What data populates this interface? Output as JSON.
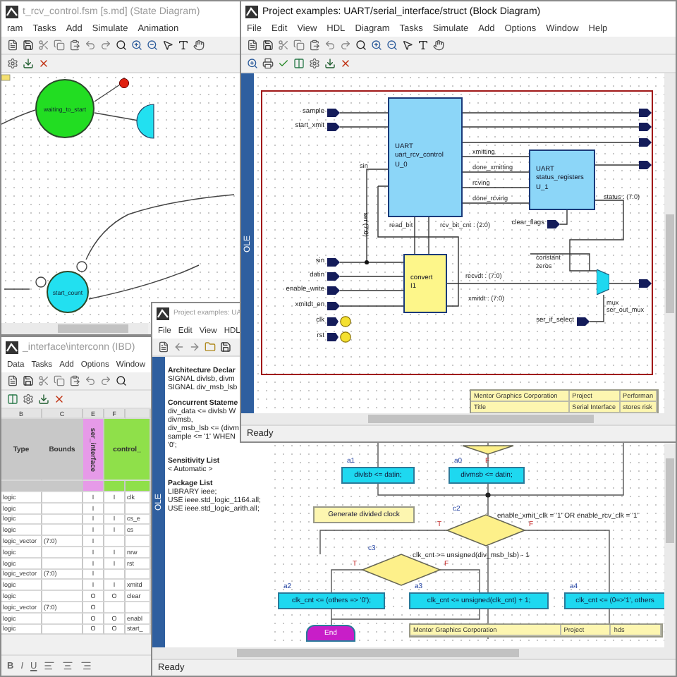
{
  "state_window": {
    "title": "t_rcv_control.fsm [s.md] (State Diagram)",
    "active": false,
    "menu": [
      "ram",
      "Tasks",
      "Add",
      "Simulate",
      "Animation"
    ],
    "states": [
      {
        "label": "waiting_to_start",
        "color": "#22dd22"
      },
      {
        "label": "start_count",
        "color": "#22e0f0"
      }
    ]
  },
  "ibd_window": {
    "title": "_interface\\interconn (IBD)",
    "active": false,
    "menu": [
      "Data",
      "Tasks",
      "Add",
      "Options",
      "Window"
    ],
    "column_letters": [
      "B",
      "C",
      "E",
      "F"
    ],
    "columns": [
      {
        "label": "Type",
        "kind": "plain"
      },
      {
        "label": "Bounds",
        "kind": "plain"
      },
      {
        "label": "ser_interface",
        "kind": "instance"
      },
      {
        "label": "control_",
        "kind": "block"
      }
    ],
    "rows": [
      {
        "type": "logic",
        "e": "I",
        "f": "I",
        "net": "clk"
      },
      {
        "type": "logic",
        "e": "I"
      },
      {
        "type": "logic",
        "e": "I",
        "f": "I",
        "net": "cs_e"
      },
      {
        "type": "logic",
        "e": "I",
        "f": "I",
        "net": "cs"
      },
      {
        "type": "logic_vector",
        "bounds": "(7:0)",
        "e": "I"
      },
      {
        "type": "logic",
        "e": "I",
        "f": "I",
        "net": "nrw"
      },
      {
        "type": "logic",
        "e": "I",
        "f": "I",
        "net": "rst"
      },
      {
        "type": "logic_vector",
        "bounds": "(7:0)",
        "e": "I"
      },
      {
        "type": "logic",
        "e": "I",
        "f": "I",
        "net": "xmitd"
      },
      {
        "type": "logic",
        "e": "O",
        "f": "O",
        "net": "clear"
      },
      {
        "type": "logic_vector",
        "bounds": "(7:0)",
        "e": "O"
      },
      {
        "type": "logic",
        "e": "O",
        "f": "O",
        "net": "enabl"
      },
      {
        "type": "logic",
        "e": "O",
        "f": "O",
        "net": "start_"
      }
    ],
    "format_buttons": [
      "B",
      "I",
      "U"
    ]
  },
  "flow_window": {
    "title": "Project examples: UA",
    "active": false,
    "menu": [
      "File",
      "Edit",
      "View",
      "HDL"
    ],
    "side_strip": "OLE",
    "declarations": [
      {
        "kind": "heading",
        "text": "Architecture Declar"
      },
      {
        "kind": "code",
        "text": "SIGNAL divlsb, divm"
      },
      {
        "kind": "code",
        "text": "SIGNAL div_msb_lsb"
      },
      {
        "kind": "heading",
        "text": "Concurrent Stateme"
      },
      {
        "kind": "code",
        "text": "div_data <= divlsb W"
      },
      {
        "kind": "code",
        "text": "divmsb,"
      },
      {
        "kind": "code",
        "text": "div_msb_lsb <= (divm"
      },
      {
        "kind": "code",
        "text": "sample <= '1' WHEN"
      },
      {
        "kind": "code",
        "text": "'0';"
      },
      {
        "kind": "heading",
        "text": "Sensitivity List"
      },
      {
        "kind": "code",
        "text": "< Automatic >"
      },
      {
        "kind": "heading",
        "text": "Package List"
      },
      {
        "kind": "code",
        "text": "LIBRARY ieee;"
      },
      {
        "kind": "code",
        "text": "USE ieee.std_logic_1164.all;"
      },
      {
        "kind": "code",
        "text": "USE ieee.std_logic_arith.all;"
      }
    ],
    "nodes": [
      {
        "kind": "action",
        "tag": "a1",
        "text": "divlsb <= datin;"
      },
      {
        "kind": "action",
        "tag": "a0",
        "text": "divmsb <= datin;",
        "branch_label": "F"
      },
      {
        "kind": "note",
        "text": "Generate divided clock"
      },
      {
        "kind": "decision",
        "tag": "c2",
        "condition": "enable_xmit_clk = '1' OR enable_rcv_clk = '1'",
        "true_label": "T",
        "false_label": "F"
      },
      {
        "kind": "decision",
        "tag": "c3",
        "condition": "clk_cnt >= unsigned(div_msb_lsb) - 1",
        "true_label": "T",
        "false_label": "F"
      },
      {
        "kind": "action",
        "tag": "a2",
        "text": "clk_cnt <= (others => '0');"
      },
      {
        "kind": "action",
        "tag": "a3",
        "text": "clk_cnt <= unsigned(clk_cnt) + 1;"
      },
      {
        "kind": "action",
        "tag": "a4",
        "text": "clk_cnt <= (0=>'1', others"
      },
      {
        "kind": "end",
        "text": "End"
      }
    ],
    "title_block": [
      "Mentor Graphics Corporation",
      "Project",
      "hds"
    ],
    "status": "Ready"
  },
  "block_window": {
    "title": "Project examples: UART/serial_interface/struct (Block Diagram)",
    "active": true,
    "menu": [
      "File",
      "Edit",
      "View",
      "HDL",
      "Diagram",
      "Tasks",
      "Simulate",
      "Add",
      "Options",
      "Window",
      "Help"
    ],
    "side_strip": "OLE",
    "ports": [
      {
        "label": "sample",
        "kind": "in"
      },
      {
        "label": "start_xmit",
        "kind": "in"
      },
      {
        "label": "sin",
        "kind": "in"
      },
      {
        "label": "datin",
        "kind": "in"
      },
      {
        "label": "enable_write",
        "kind": "in"
      },
      {
        "label": "xmitdt_en",
        "kind": "in"
      },
      {
        "label": "clk",
        "kind": "global"
      },
      {
        "label": "rst",
        "kind": "global"
      },
      {
        "label": "clear_flags",
        "kind": "in"
      },
      {
        "label": "ser_if_select",
        "kind": "in"
      }
    ],
    "blocks": [
      {
        "kind": "component",
        "lines": [
          "UART",
          "uart_rcv_control",
          "U_0"
        ]
      },
      {
        "kind": "component",
        "lines": [
          "UART",
          "status_registers",
          "U_1"
        ]
      },
      {
        "kind": "embedded",
        "lines": [
          "convert",
          "I1"
        ]
      },
      {
        "kind": "mux",
        "lines": [
          "mux",
          "ser_out_mux"
        ]
      }
    ],
    "signals": [
      "sin",
      "ser (7:0)",
      "xmitting",
      "done_xmitting",
      "rcving",
      "done_rcving",
      "read_bit",
      "rcv_bit_cnt : (2:0)",
      "status : (7:0)",
      "recvdt : (7:0)",
      "xmitdt : (7:0)",
      "constant",
      "zeros"
    ],
    "title_block": [
      "Mentor Graphics Corporation",
      "Project",
      "Performan",
      "Title",
      "Serial Interface",
      "stores risk"
    ],
    "status": "Ready"
  }
}
